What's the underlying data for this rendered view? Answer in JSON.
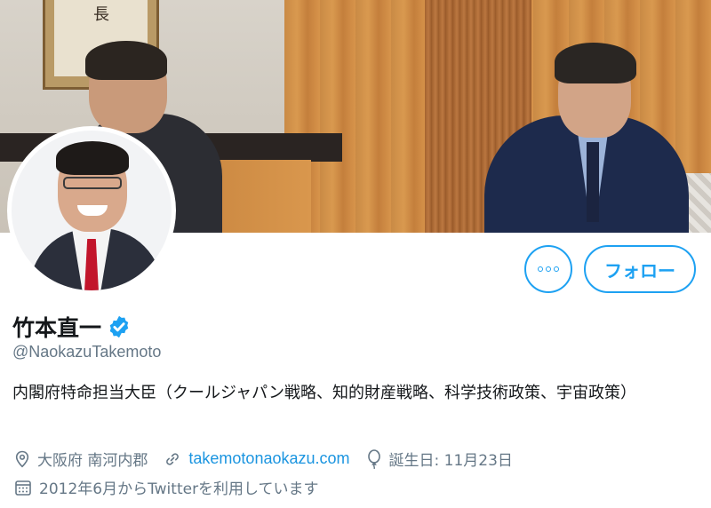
{
  "banner": {
    "scroll_text": "長"
  },
  "buttons": {
    "follow_label": "フォロー"
  },
  "profile": {
    "name": "竹本直一",
    "handle": "@NaokazuTakemoto",
    "bio": "内閣府特命担当大臣（クールジャパン戦略、知的財産戦略、科学技術政策、宇宙政策）"
  },
  "meta": {
    "location": "大阪府 南河内郡",
    "website": "takemotonaokazu.com",
    "birthday": "誕生日: 11月23日",
    "joined": "2012年6月からTwitterを利用しています"
  },
  "colors": {
    "accent": "#1da1f2",
    "link": "#1b95e0",
    "secondary_text": "#657786"
  },
  "icons": {
    "verified": "verified-badge-icon",
    "location": "location-pin-icon",
    "website": "link-icon",
    "birthday": "balloon-icon",
    "joined": "calendar-icon",
    "more": "more-options-icon"
  }
}
